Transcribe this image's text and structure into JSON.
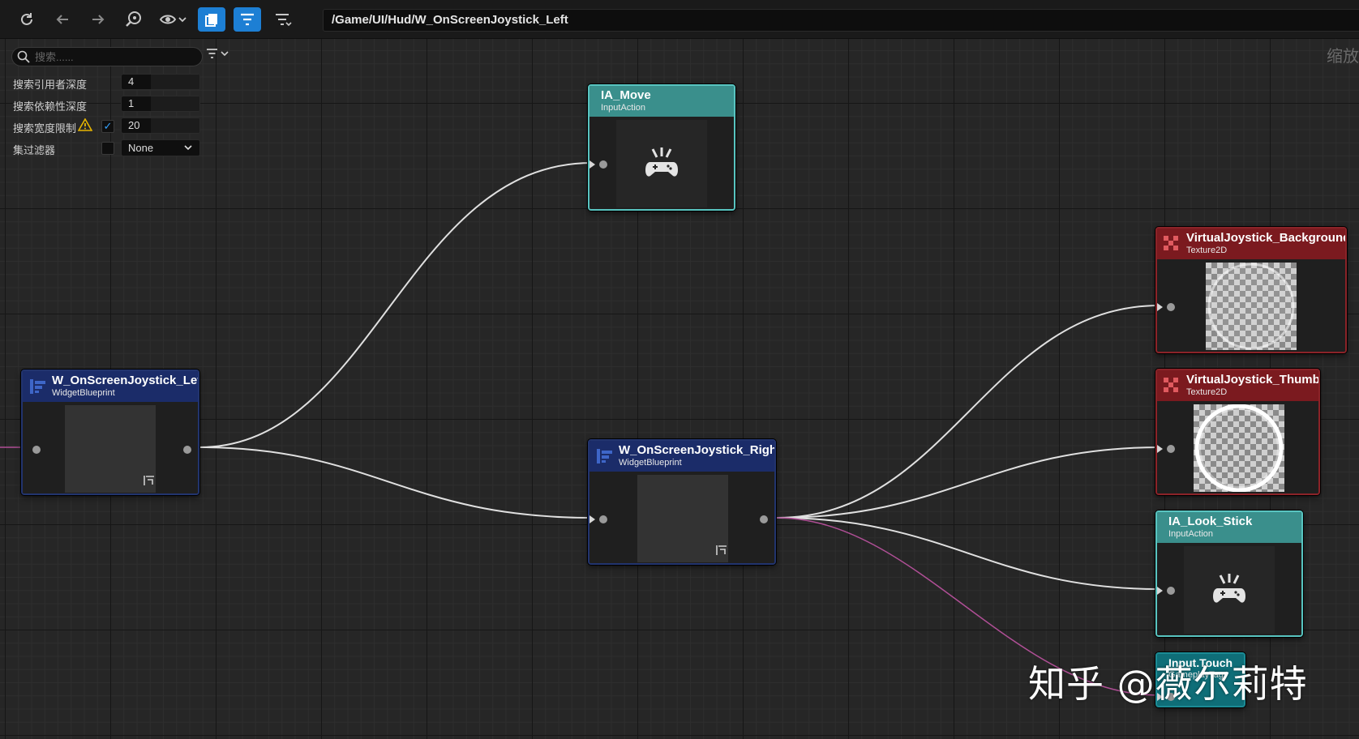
{
  "toolbar": {
    "buttons": [
      {
        "name": "refresh-icon"
      },
      {
        "name": "back-arrow-icon"
      },
      {
        "name": "forward-arrow-icon"
      },
      {
        "name": "find-asset-icon"
      },
      {
        "name": "visibility-eye-icon"
      },
      {
        "name": "copy-pages-icon",
        "active": true
      },
      {
        "name": "filter-icon",
        "active": true
      },
      {
        "name": "filter-options-icon"
      }
    ],
    "path": "/Game/UI/Hud/W_OnScreenJoystick_Left",
    "accent": "#1d7fd4"
  },
  "settings": {
    "search_placeholder": "搜索......",
    "rows": [
      {
        "label": "搜索引用者深度",
        "value": "4"
      },
      {
        "label": "搜索依赖性深度",
        "value": "1"
      },
      {
        "label": "搜索宽度限制",
        "value": "20",
        "checked": true,
        "warning": true
      },
      {
        "label": "集过滤器",
        "value": "None",
        "checked": false
      }
    ]
  },
  "zoom_label": "缩放",
  "nodes": {
    "left": {
      "title": "W_OnScreenJoystick_Left",
      "type": "WidgetBlueprint"
    },
    "right": {
      "title": "W_OnScreenJoystick_Right",
      "type": "WidgetBlueprint"
    },
    "ia_move": {
      "title": "IA_Move",
      "type": "InputAction"
    },
    "vj_bg": {
      "title": "VirtualJoystick_Background",
      "type": "Texture2D"
    },
    "vj_thumb": {
      "title": "VirtualJoystick_Thumb",
      "type": "Texture2D"
    },
    "ia_look": {
      "title": "IA_Look_Stick",
      "type": "InputAction"
    },
    "input_touch": {
      "title": "Input.Touch",
      "type": "GameplayTag"
    }
  },
  "colors": {
    "teal_header": "#3a8f8c",
    "blue_header": "#1b2c69",
    "red_header": "#7b1a1f",
    "wire": "#e0e0e0",
    "tag_wire": "#b04f96"
  },
  "watermark": "知乎 @薇尔莉特"
}
